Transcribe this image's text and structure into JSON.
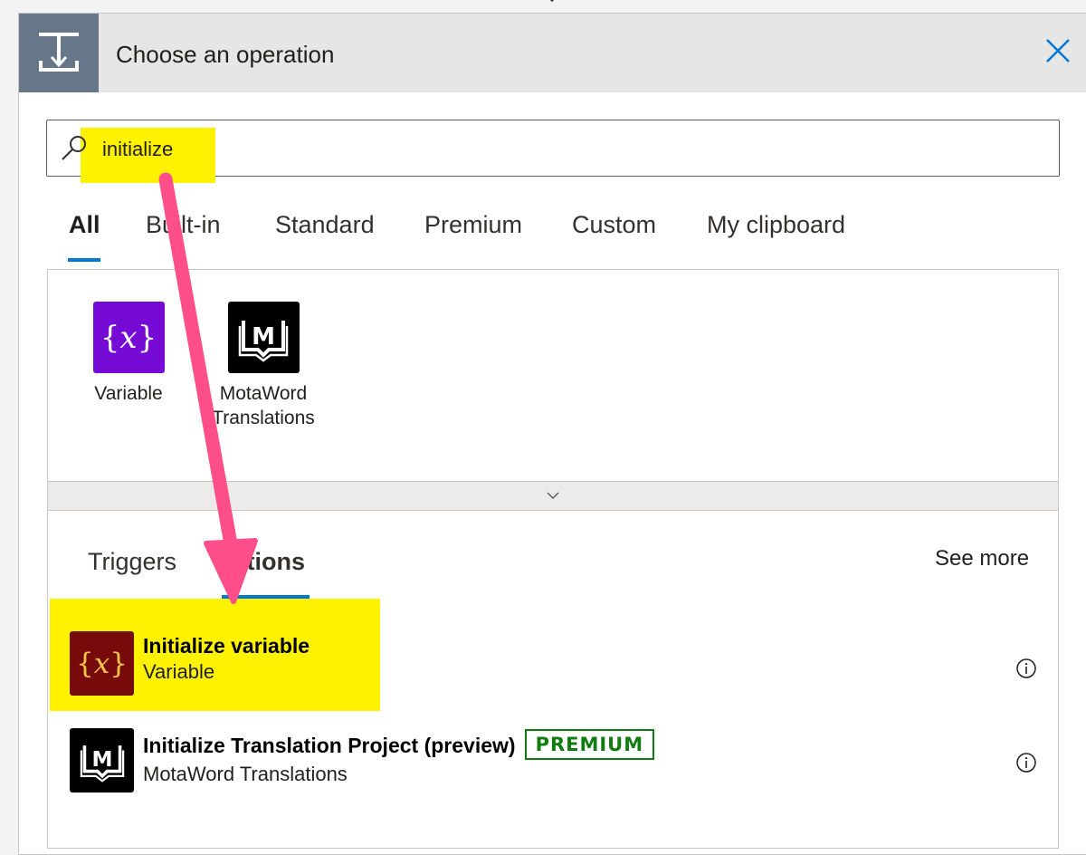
{
  "header": {
    "title": "Choose an operation"
  },
  "search": {
    "value": "initialize"
  },
  "tabs": [
    {
      "label": "All",
      "active": true
    },
    {
      "label": "Built-in"
    },
    {
      "label": "Standard"
    },
    {
      "label": "Premium"
    },
    {
      "label": "Custom"
    },
    {
      "label": "My clipboard"
    }
  ],
  "connectors": [
    {
      "line1": "Variable",
      "line2": "",
      "icon": "variable-icon",
      "color": "#770bd6"
    },
    {
      "line1": "MotaWord",
      "line2": "Translations",
      "icon": "motaword-icon",
      "color": "#000000"
    }
  ],
  "subtabs": [
    {
      "label": "Triggers"
    },
    {
      "label": "Actions",
      "active": true
    }
  ],
  "see_more": "See more",
  "results": [
    {
      "title": "Initialize variable",
      "subtitle": "Variable",
      "icon": "variable-icon",
      "color": "#770b0b",
      "highlighted": true
    },
    {
      "title": "Initialize Translation Project (preview)",
      "subtitle": "MotaWord Translations",
      "badge": "PREMIUM",
      "icon": "motaword-icon",
      "color": "#000000"
    }
  ],
  "colors": {
    "accent": "#0078d4",
    "highlight": "#fff200",
    "annotation_arrow": "#ff4f8b",
    "premium": "#107c10",
    "header_icon": "#68768a"
  }
}
